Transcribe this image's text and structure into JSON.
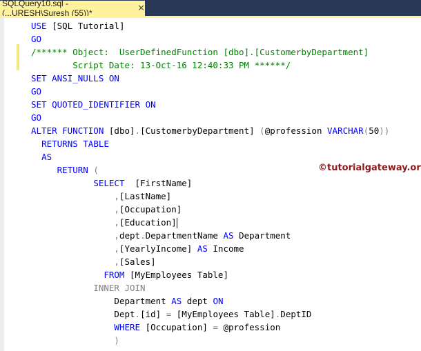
{
  "tab": {
    "title": "SQLQuery10.sql - (...URESH\\Suresh (55))*",
    "close": "✕"
  },
  "watermark": "©tutorialgateway.org",
  "lines": [
    [
      [
        "kw",
        "USE "
      ],
      [
        "pl",
        "[SQL Tutorial]"
      ]
    ],
    [
      [
        "kw",
        "GO"
      ]
    ],
    [
      [
        "cm",
        "/****** Object:  UserDefinedFunction [dbo].[CustomerbyDepartment]"
      ]
    ],
    [
      [
        "cm",
        "        Script Date: 13-Oct-16 12:40:33 PM ******/"
      ]
    ],
    [
      [
        "kw",
        "SET ANSI_NULLS ON"
      ]
    ],
    [
      [
        "kw",
        "GO"
      ]
    ],
    [
      [
        "kw",
        "SET QUOTED_IDENTIFIER ON"
      ]
    ],
    [
      [
        "kw",
        "GO"
      ]
    ],
    [
      [
        "kw",
        "ALTER FUNCTION "
      ],
      [
        "pl",
        "[dbo]"
      ],
      [
        "gr",
        "."
      ],
      [
        "pl",
        "[CustomerbyDepartment] "
      ],
      [
        "gr",
        "("
      ],
      [
        "pl",
        "@profession "
      ],
      [
        "kw",
        "VARCHAR"
      ],
      [
        "gr",
        "("
      ],
      [
        "pl",
        "50"
      ],
      [
        "gr",
        "))"
      ]
    ],
    [
      [
        "pl",
        "  "
      ],
      [
        "kw",
        "RETURNS TABLE"
      ]
    ],
    [
      [
        "pl",
        "  "
      ],
      [
        "kw",
        "AS"
      ]
    ],
    [
      [
        "pl",
        "     "
      ],
      [
        "kw",
        "RETURN "
      ],
      [
        "gr",
        "("
      ]
    ],
    [
      [
        "pl",
        "            "
      ],
      [
        "kw",
        "SELECT  "
      ],
      [
        "pl",
        "[FirstName]"
      ]
    ],
    [
      [
        "pl",
        "                "
      ],
      [
        "gr",
        ","
      ],
      [
        "pl",
        "[LastName]"
      ]
    ],
    [
      [
        "pl",
        "                "
      ],
      [
        "gr",
        ","
      ],
      [
        "pl",
        "[Occupation]"
      ]
    ],
    [
      [
        "pl",
        "                "
      ],
      [
        "gr",
        ","
      ],
      [
        "pl",
        "[Education]"
      ]
    ],
    [
      [
        "pl",
        "                "
      ],
      [
        "gr",
        ","
      ],
      [
        "pl",
        "dept"
      ],
      [
        "gr",
        "."
      ],
      [
        "pl",
        "DepartmentName "
      ],
      [
        "kw",
        "AS "
      ],
      [
        "pl",
        "Department"
      ]
    ],
    [
      [
        "pl",
        "                "
      ],
      [
        "gr",
        ","
      ],
      [
        "pl",
        "[YearlyIncome] "
      ],
      [
        "kw",
        "AS "
      ],
      [
        "pl",
        "Income"
      ]
    ],
    [
      [
        "pl",
        "                "
      ],
      [
        "gr",
        ","
      ],
      [
        "pl",
        "[Sales]"
      ]
    ],
    [
      [
        "pl",
        "              "
      ],
      [
        "kw",
        "FROM "
      ],
      [
        "pl",
        "[MyEmployees Table]"
      ]
    ],
    [
      [
        "pl",
        "            "
      ],
      [
        "gr",
        "INNER JOIN"
      ]
    ],
    [
      [
        "pl",
        "                "
      ],
      [
        "pl",
        "Department "
      ],
      [
        "kw",
        "AS "
      ],
      [
        "pl",
        "dept "
      ],
      [
        "kw",
        "ON"
      ]
    ],
    [
      [
        "pl",
        "                "
      ],
      [
        "pl",
        "Dept"
      ],
      [
        "gr",
        "."
      ],
      [
        "pl",
        "[id] "
      ],
      [
        "gr",
        "= "
      ],
      [
        "pl",
        "[MyEmployees Table]"
      ],
      [
        "gr",
        "."
      ],
      [
        "pl",
        "DeptID"
      ]
    ],
    [
      [
        "pl",
        "                "
      ],
      [
        "kw",
        "WHERE "
      ],
      [
        "pl",
        "[Occupation] "
      ],
      [
        "gr",
        "= "
      ],
      [
        "pl",
        "@profession"
      ]
    ],
    [
      [
        "pl",
        "                "
      ],
      [
        "gr",
        ")"
      ]
    ]
  ]
}
